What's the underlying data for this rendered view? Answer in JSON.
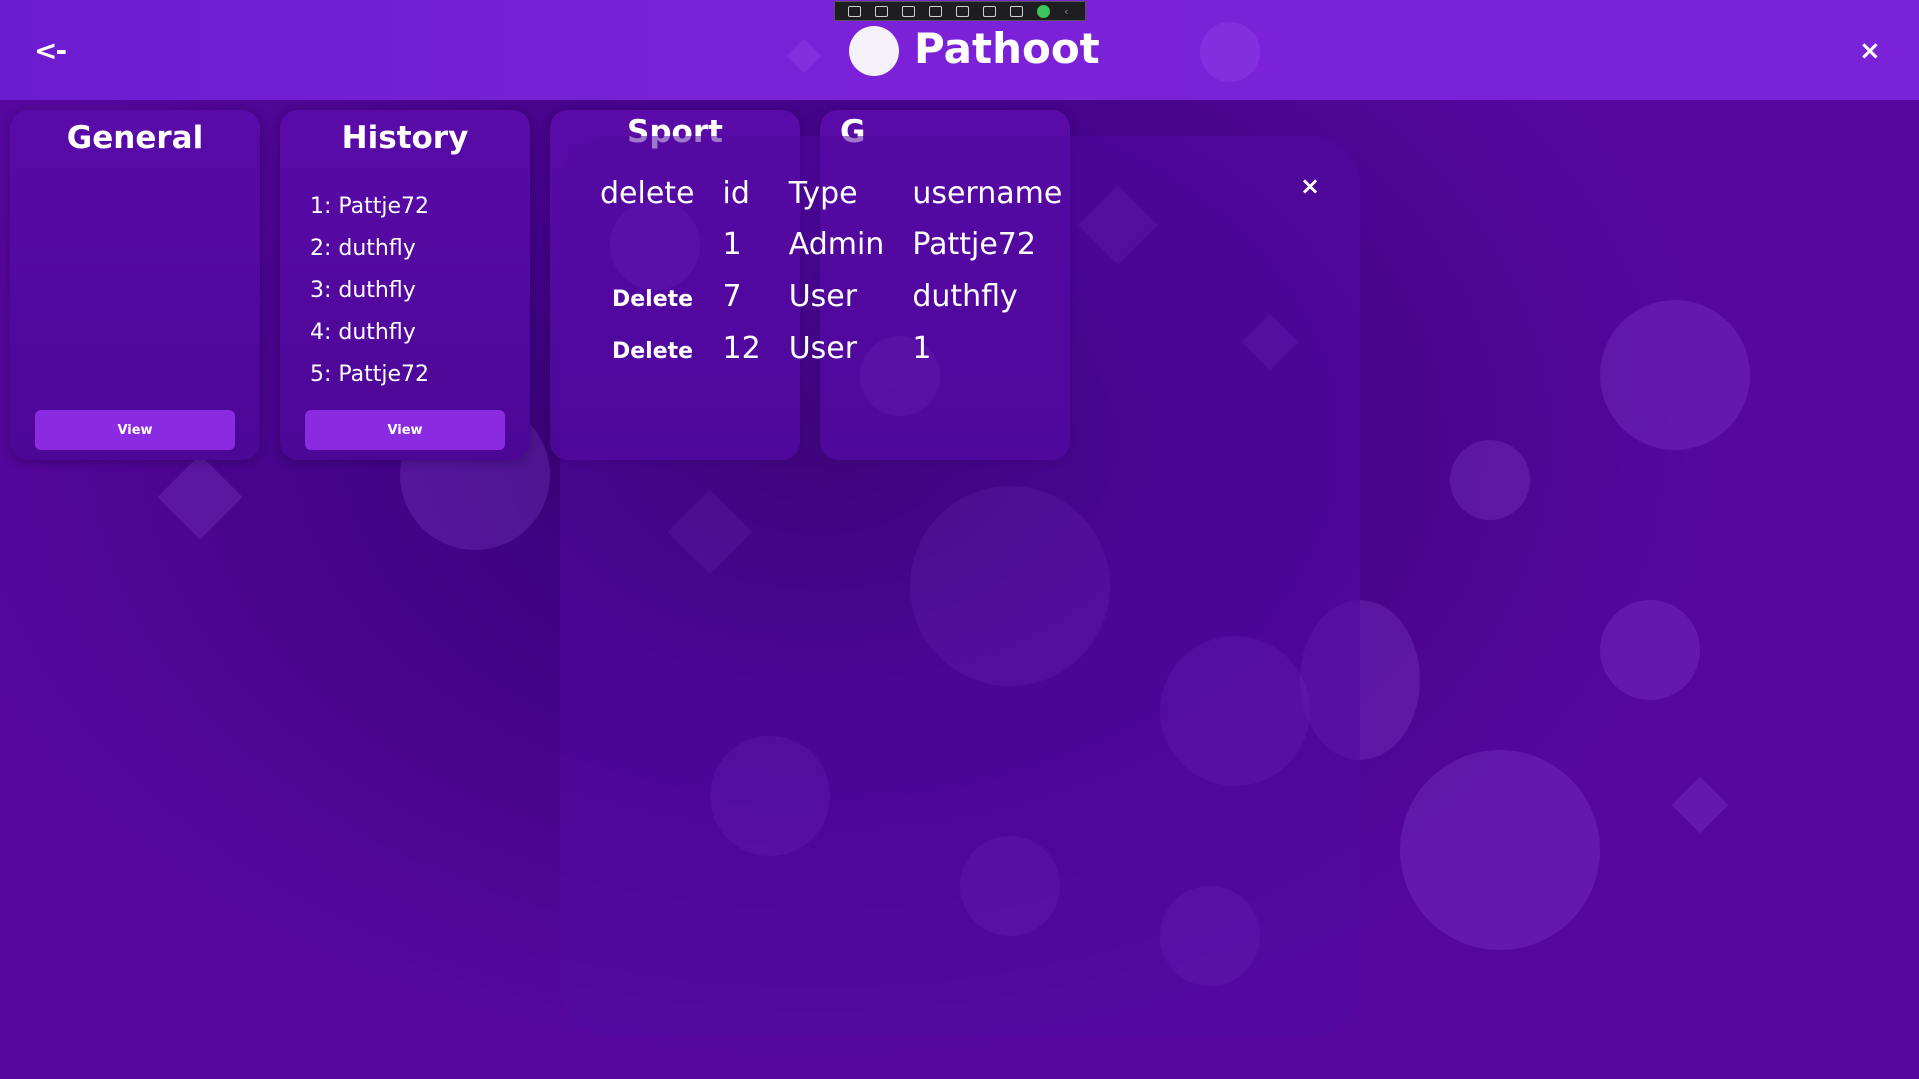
{
  "header": {
    "back_label": "<-",
    "title": "Pathoot",
    "close_label": "×"
  },
  "categories": [
    {
      "title": "General",
      "items": [],
      "button": "View"
    },
    {
      "title": "History",
      "items": [
        "1: Pattje72",
        "2: duthfly",
        "3: duthfly",
        "4: duthfly",
        "5: Pattje72"
      ],
      "button": "View"
    },
    {
      "title": "Sport"
    },
    {
      "title": "G"
    }
  ],
  "modal": {
    "close_label": "×",
    "columns": [
      "delete",
      "id",
      "Type",
      "username"
    ],
    "rows": [
      {
        "delete": "",
        "id": "1",
        "type": "Admin",
        "username": "Pattje72"
      },
      {
        "delete": "Delete",
        "id": "7",
        "type": "User",
        "username": "duthfly"
      },
      {
        "delete": "Delete",
        "id": "12",
        "type": "User",
        "username": "1"
      }
    ]
  },
  "colors": {
    "header": "#7b22d9",
    "accent_button": "#8a2be2",
    "background": "#4b0590"
  }
}
